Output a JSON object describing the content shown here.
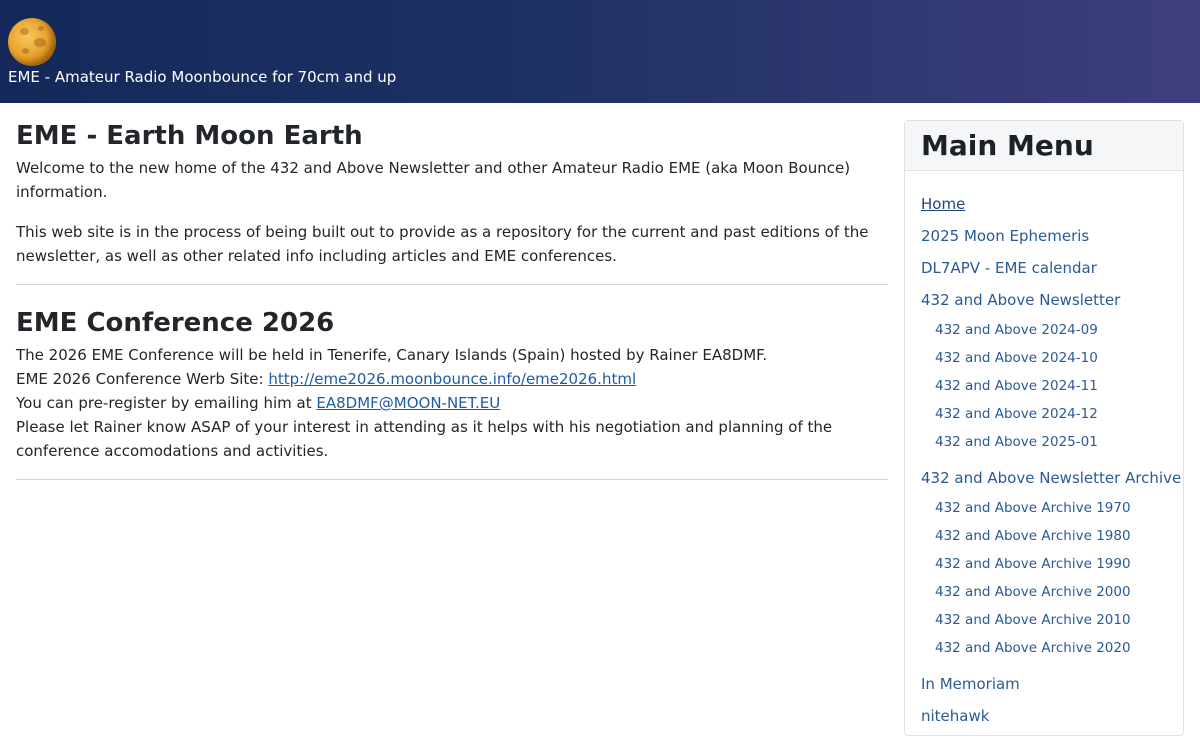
{
  "header": {
    "site_title": "EME - Amateur Radio Moonbounce for 70cm and up",
    "logo_icon": "moon-icon",
    "gradient_colors": [
      "#14285a",
      "#3f3f7e"
    ]
  },
  "intro": {
    "heading": "EME - Earth Moon Earth",
    "paragraph1": "Welcome to the new home of the 432 and Above Newsletter and other Amateur Radio EME (aka Moon Bounce) information.",
    "paragraph2": "This web site is in the process of being built out to provide as a repository for the current and past editions of the newsletter, as well as other related info including articles and EME conferences."
  },
  "conference": {
    "heading": "EME Conference 2026",
    "line1": "The 2026 EME Conference will be held in Tenerife, Canary Islands (Spain) hosted by Rainer EA8DMF.",
    "site_label": "EME 2026 Conference Werb Site: ",
    "site_link": "http://eme2026.moonbounce.info/eme2026.html",
    "register_label": "You can pre-register by emailing him at ",
    "register_email": "EA8DMF@MOON-NET.EU",
    "line4": "Please let Rainer know ASAP of your interest in attending as it helps with his negotiation and planning of the conference accomodations and activities."
  },
  "sidebar": {
    "title": "Main Menu",
    "items": [
      {
        "label": "Home",
        "current": true
      },
      {
        "label": "2025 Moon Ephemeris"
      },
      {
        "label": "DL7APV - EME calendar"
      },
      {
        "label": "432 and Above Newsletter",
        "children": [
          "432 and Above 2024-09",
          "432 and Above 2024-10",
          "432 and Above 2024-11",
          "432 and Above 2024-12",
          "432 and Above 2025-01"
        ]
      },
      {
        "label": "432 and Above Newsletter Archive",
        "children": [
          "432 and Above Archive 1970",
          "432 and Above Archive 1980",
          "432 and Above Archive 1990",
          "432 and Above Archive 2000",
          "432 and Above Archive 2010",
          "432 and Above Archive 2020"
        ]
      },
      {
        "label": "In Memoriam"
      },
      {
        "label": "nitehawk"
      }
    ]
  }
}
